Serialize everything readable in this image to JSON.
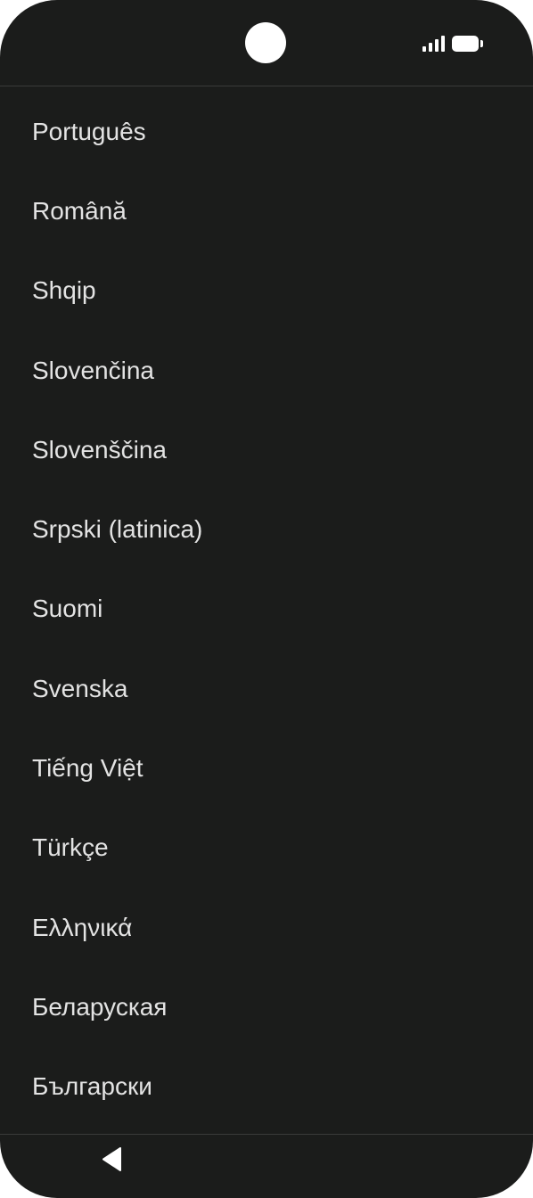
{
  "status_bar": {
    "signal_icon": "signal-strength-icon",
    "battery_icon": "battery-full-icon"
  },
  "language_list": {
    "items": [
      {
        "label": "Português"
      },
      {
        "label": "Română"
      },
      {
        "label": "Shqip"
      },
      {
        "label": "Slovenčina"
      },
      {
        "label": "Slovenščina"
      },
      {
        "label": "Srpski (latinica)"
      },
      {
        "label": "Suomi"
      },
      {
        "label": "Svenska"
      },
      {
        "label": "Tiếng Việt"
      },
      {
        "label": "Türkçe"
      },
      {
        "label": "Ελληνικά"
      },
      {
        "label": "Беларуская"
      },
      {
        "label": "Български"
      }
    ]
  },
  "nav_bar": {
    "back_icon": "back-triangle-icon"
  },
  "colors": {
    "background": "#1b1c1b",
    "text": "#e3e3e3",
    "divider": "#3a3b3a",
    "icon": "#ffffff"
  }
}
